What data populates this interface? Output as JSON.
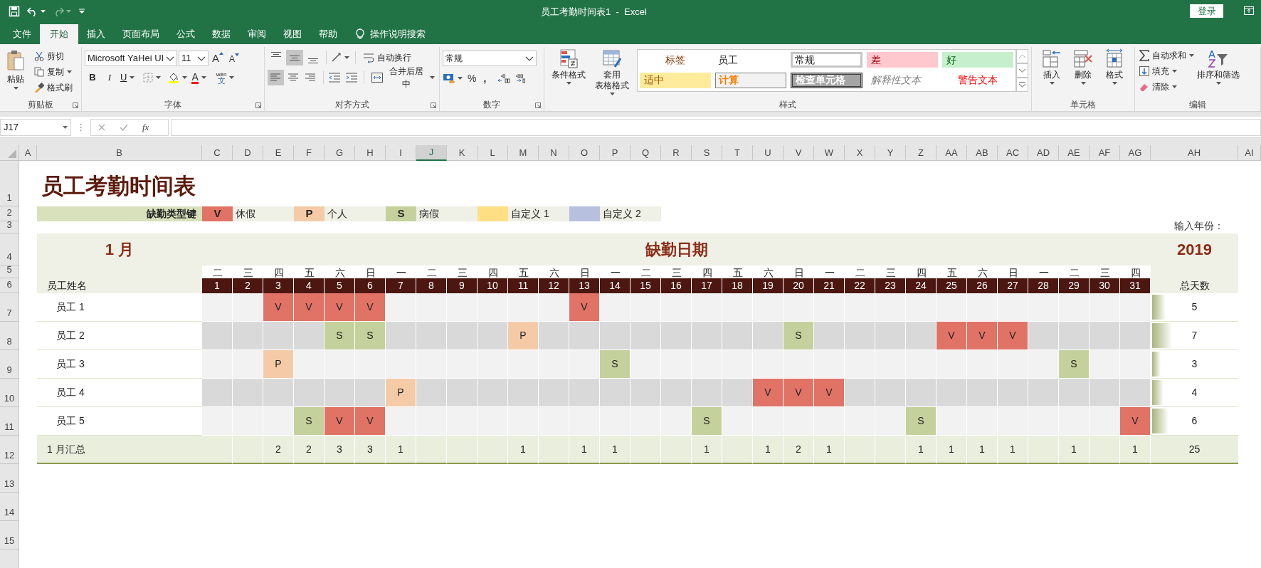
{
  "window": {
    "title": "员工考勤时间表1  -  Excel",
    "sign_in": "登录"
  },
  "ribbon_tabs": [
    {
      "label": "文件",
      "selected": false
    },
    {
      "label": "开始",
      "selected": true
    },
    {
      "label": "插入",
      "selected": false
    },
    {
      "label": "页面布局",
      "selected": false
    },
    {
      "label": "公式",
      "selected": false
    },
    {
      "label": "数据",
      "selected": false
    },
    {
      "label": "审阅",
      "selected": false
    },
    {
      "label": "视图",
      "selected": false
    },
    {
      "label": "帮助",
      "selected": false
    }
  ],
  "tell_me": "操作说明搜索",
  "clipboard": {
    "label": "剪贴板",
    "paste": "粘贴",
    "cut": "剪切",
    "copy": "复制",
    "format_painter": "格式刷"
  },
  "font": {
    "label": "字体",
    "font_name": "Microsoft YaHei UI",
    "font_size": "11",
    "grow": "A",
    "shrink": "A",
    "bold": "B",
    "italic": "I",
    "underline": "U",
    "font_color": "A",
    "phonetic_top": "wén",
    "phonetic_bottom": "文"
  },
  "alignment": {
    "label": "对齐方式",
    "vertical_align_buttons": [
      {
        "selected": false
      },
      {
        "selected": true
      },
      {
        "selected": false
      }
    ],
    "horizontal_align_buttons": [
      {
        "selected": true
      },
      {
        "selected": false
      },
      {
        "selected": false
      }
    ],
    "wrap_text": "自动换行",
    "merge_center": "合并后居中"
  },
  "number": {
    "label": "数字",
    "format": "常规",
    "percent": "%",
    "comma": ","
  },
  "styles": {
    "label": "样式",
    "conditional_formatting": "条件格式",
    "format_as_table": "套用表格格式",
    "gallery": [
      {
        "label": "标签",
        "kind": "heading",
        "selected": false
      },
      {
        "label": "员工",
        "kind": "plain",
        "selected": false
      },
      {
        "label": "常规",
        "kind": "normal",
        "selected": true
      },
      {
        "label": "差",
        "kind": "bad",
        "selected": false
      },
      {
        "label": "好",
        "kind": "good",
        "selected": false
      },
      {
        "label": "适中",
        "kind": "neutral",
        "selected": false
      },
      {
        "label": "计算",
        "kind": "calculation",
        "selected": false
      },
      {
        "label": "检查单元格",
        "kind": "check",
        "selected": false
      },
      {
        "label": "解释性文本",
        "kind": "explanatory",
        "selected": false
      },
      {
        "label": "警告文本",
        "kind": "warning",
        "selected": false
      }
    ]
  },
  "cells": {
    "label": "单元格",
    "insert": "插入",
    "delete": "删除",
    "format": "格式"
  },
  "editing": {
    "label": "编辑",
    "autosum": "自动求和",
    "fill": "填充",
    "clear": "清除",
    "sort_filter": "排序和筛选"
  },
  "formula_bar": {
    "name_box": "J17",
    "fx": "fx"
  },
  "sheet_columns": [
    {
      "label": "A",
      "selected": false
    },
    {
      "label": "B",
      "selected": false
    },
    {
      "label": "C",
      "selected": false
    },
    {
      "label": "D",
      "selected": false
    },
    {
      "label": "E",
      "selected": false
    },
    {
      "label": "F",
      "selected": false
    },
    {
      "label": "G",
      "selected": false
    },
    {
      "label": "H",
      "selected": false
    },
    {
      "label": "I",
      "selected": false
    },
    {
      "label": "J",
      "selected": true
    },
    {
      "label": "K",
      "selected": false
    },
    {
      "label": "L",
      "selected": false
    },
    {
      "label": "M",
      "selected": false
    },
    {
      "label": "N",
      "selected": false
    },
    {
      "label": "O",
      "selected": false
    },
    {
      "label": "P",
      "selected": false
    },
    {
      "label": "Q",
      "selected": false
    },
    {
      "label": "R",
      "selected": false
    },
    {
      "label": "S",
      "selected": false
    },
    {
      "label": "T",
      "selected": false
    },
    {
      "label": "U",
      "selected": false
    },
    {
      "label": "V",
      "selected": false
    },
    {
      "label": "W",
      "selected": false
    },
    {
      "label": "X",
      "selected": false
    },
    {
      "label": "Y",
      "selected": false
    },
    {
      "label": "Z",
      "selected": false
    },
    {
      "label": "AA",
      "selected": false
    },
    {
      "label": "AB",
      "selected": false
    },
    {
      "label": "AC",
      "selected": false
    },
    {
      "label": "AD",
      "selected": false
    },
    {
      "label": "AE",
      "selected": false
    },
    {
      "label": "AF",
      "selected": false
    },
    {
      "label": "AG",
      "selected": false
    },
    {
      "label": "AH",
      "selected": false
    },
    {
      "label": "AI",
      "selected": false
    }
  ],
  "row_numbers": [
    "1",
    "2",
    "3",
    "4",
    "5",
    "6",
    "7",
    "8",
    "9",
    "10",
    "11",
    "12",
    "13",
    "14",
    "15"
  ],
  "sheet": {
    "title": "员工考勤时间表",
    "legend": {
      "label": "缺勤类型键",
      "items": [
        {
          "code": "V",
          "label": "休假",
          "color": "#e07366"
        },
        {
          "code": "P",
          "label": "个人",
          "color": "#f5cba7"
        },
        {
          "code": "S",
          "label": "病假",
          "color": "#c4d19c"
        },
        {
          "label": "自定义 1",
          "color": "#fedf84"
        },
        {
          "label": "自定义 2",
          "color": "#b7c0de"
        }
      ]
    },
    "year_label": "输入年份：",
    "month": "1 月",
    "period_label": "缺勤日期",
    "year": "2019",
    "weekdays": [
      "二",
      "三",
      "四",
      "五",
      "六",
      "日",
      "一",
      "二",
      "三",
      "四",
      "五",
      "六",
      "日",
      "一",
      "二",
      "三",
      "四",
      "五",
      "六",
      "日",
      "一",
      "二",
      "三",
      "四",
      "五",
      "六",
      "日",
      "一",
      "二",
      "三",
      "四"
    ],
    "days": [
      "1",
      "2",
      "3",
      "4",
      "5",
      "6",
      "7",
      "8",
      "9",
      "10",
      "11",
      "12",
      "13",
      "14",
      "15",
      "16",
      "17",
      "18",
      "19",
      "20",
      "21",
      "22",
      "23",
      "24",
      "25",
      "26",
      "27",
      "28",
      "29",
      "30",
      "31"
    ],
    "name_header": "员工姓名",
    "total_header": "总天数",
    "employees": [
      {
        "name": "员工 1",
        "total": "5",
        "level": 0.16,
        "days": [
          {
            "kind": "present"
          },
          {
            "kind": "present"
          },
          {
            "kind": "absent",
            "code": "V",
            "color": "#e07366"
          },
          {
            "kind": "absent",
            "code": "V",
            "color": "#e07366"
          },
          {
            "kind": "absent",
            "code": "V",
            "color": "#e07366"
          },
          {
            "kind": "absent",
            "code": "V",
            "color": "#e07366"
          },
          {
            "kind": "present"
          },
          {
            "kind": "present"
          },
          {
            "kind": "present"
          },
          {
            "kind": "present"
          },
          {
            "kind": "present"
          },
          {
            "kind": "present"
          },
          {
            "kind": "absent",
            "code": "V",
            "color": "#e07366"
          },
          {
            "kind": "present"
          },
          {
            "kind": "present"
          },
          {
            "kind": "present"
          },
          {
            "kind": "present"
          },
          {
            "kind": "present"
          },
          {
            "kind": "present"
          },
          {
            "kind": "present"
          },
          {
            "kind": "present"
          },
          {
            "kind": "present"
          },
          {
            "kind": "present"
          },
          {
            "kind": "present"
          },
          {
            "kind": "present"
          },
          {
            "kind": "present"
          },
          {
            "kind": "present"
          },
          {
            "kind": "present"
          },
          {
            "kind": "present"
          },
          {
            "kind": "present"
          },
          {
            "kind": "present"
          }
        ]
      },
      {
        "name": "员工 2",
        "total": "7",
        "level": 0.23,
        "days": [
          {
            "kind": "present"
          },
          {
            "kind": "present"
          },
          {
            "kind": "present"
          },
          {
            "kind": "present"
          },
          {
            "kind": "absent",
            "code": "S",
            "color": "#c4d19c"
          },
          {
            "kind": "absent",
            "code": "S",
            "color": "#c4d19c"
          },
          {
            "kind": "present"
          },
          {
            "kind": "present"
          },
          {
            "kind": "present"
          },
          {
            "kind": "present"
          },
          {
            "kind": "absent",
            "code": "P",
            "color": "#f5cba7"
          },
          {
            "kind": "present"
          },
          {
            "kind": "present"
          },
          {
            "kind": "present"
          },
          {
            "kind": "present"
          },
          {
            "kind": "present"
          },
          {
            "kind": "present"
          },
          {
            "kind": "present"
          },
          {
            "kind": "present"
          },
          {
            "kind": "absent",
            "code": "S",
            "color": "#c4d19c"
          },
          {
            "kind": "present"
          },
          {
            "kind": "present"
          },
          {
            "kind": "present"
          },
          {
            "kind": "present"
          },
          {
            "kind": "absent",
            "code": "V",
            "color": "#e07366"
          },
          {
            "kind": "absent",
            "code": "V",
            "color": "#e07366"
          },
          {
            "kind": "absent",
            "code": "V",
            "color": "#e07366"
          },
          {
            "kind": "present"
          },
          {
            "kind": "present"
          },
          {
            "kind": "present"
          },
          {
            "kind": "present"
          }
        ]
      },
      {
        "name": "员工 3",
        "total": "3",
        "level": 0.1,
        "days": [
          {
            "kind": "present"
          },
          {
            "kind": "present"
          },
          {
            "kind": "absent",
            "code": "P",
            "color": "#f5cba7"
          },
          {
            "kind": "present"
          },
          {
            "kind": "present"
          },
          {
            "kind": "present"
          },
          {
            "kind": "present"
          },
          {
            "kind": "present"
          },
          {
            "kind": "present"
          },
          {
            "kind": "present"
          },
          {
            "kind": "present"
          },
          {
            "kind": "present"
          },
          {
            "kind": "present"
          },
          {
            "kind": "absent",
            "code": "S",
            "color": "#c4d19c"
          },
          {
            "kind": "present"
          },
          {
            "kind": "present"
          },
          {
            "kind": "present"
          },
          {
            "kind": "present"
          },
          {
            "kind": "present"
          },
          {
            "kind": "present"
          },
          {
            "kind": "present"
          },
          {
            "kind": "present"
          },
          {
            "kind": "present"
          },
          {
            "kind": "present"
          },
          {
            "kind": "present"
          },
          {
            "kind": "present"
          },
          {
            "kind": "present"
          },
          {
            "kind": "present"
          },
          {
            "kind": "absent",
            "code": "S",
            "color": "#c4d19c"
          },
          {
            "kind": "present"
          },
          {
            "kind": "present"
          }
        ]
      },
      {
        "name": "员工 4",
        "total": "4",
        "level": 0.13,
        "days": [
          {
            "kind": "present"
          },
          {
            "kind": "present"
          },
          {
            "kind": "present"
          },
          {
            "kind": "present"
          },
          {
            "kind": "present"
          },
          {
            "kind": "present"
          },
          {
            "kind": "absent",
            "code": "P",
            "color": "#f5cba7"
          },
          {
            "kind": "present"
          },
          {
            "kind": "present"
          },
          {
            "kind": "present"
          },
          {
            "kind": "present"
          },
          {
            "kind": "present"
          },
          {
            "kind": "present"
          },
          {
            "kind": "present"
          },
          {
            "kind": "present"
          },
          {
            "kind": "present"
          },
          {
            "kind": "present"
          },
          {
            "kind": "present"
          },
          {
            "kind": "absent",
            "code": "V",
            "color": "#e07366"
          },
          {
            "kind": "absent",
            "code": "V",
            "color": "#e07366"
          },
          {
            "kind": "absent",
            "code": "V",
            "color": "#e07366"
          },
          {
            "kind": "present"
          },
          {
            "kind": "present"
          },
          {
            "kind": "present"
          },
          {
            "kind": "present"
          },
          {
            "kind": "present"
          },
          {
            "kind": "present"
          },
          {
            "kind": "present"
          },
          {
            "kind": "present"
          },
          {
            "kind": "present"
          },
          {
            "kind": "present"
          }
        ]
      },
      {
        "name": "员工 5",
        "total": "6",
        "level": 0.19,
        "days": [
          {
            "kind": "present"
          },
          {
            "kind": "present"
          },
          {
            "kind": "present"
          },
          {
            "kind": "absent",
            "code": "S",
            "color": "#c4d19c"
          },
          {
            "kind": "absent",
            "code": "V",
            "color": "#e07366"
          },
          {
            "kind": "absent",
            "code": "V",
            "color": "#e07366"
          },
          {
            "kind": "present"
          },
          {
            "kind": "present"
          },
          {
            "kind": "present"
          },
          {
            "kind": "present"
          },
          {
            "kind": "present"
          },
          {
            "kind": "present"
          },
          {
            "kind": "present"
          },
          {
            "kind": "present"
          },
          {
            "kind": "present"
          },
          {
            "kind": "present"
          },
          {
            "kind": "absent",
            "code": "S",
            "color": "#c4d19c"
          },
          {
            "kind": "present"
          },
          {
            "kind": "present"
          },
          {
            "kind": "present"
          },
          {
            "kind": "present"
          },
          {
            "kind": "present"
          },
          {
            "kind": "present"
          },
          {
            "kind": "absent",
            "code": "S",
            "color": "#c4d19c"
          },
          {
            "kind": "present"
          },
          {
            "kind": "present"
          },
          {
            "kind": "present"
          },
          {
            "kind": "present"
          },
          {
            "kind": "present"
          },
          {
            "kind": "present"
          },
          {
            "kind": "absent",
            "code": "V",
            "color": "#e07366"
          }
        ]
      }
    ],
    "summary": {
      "label": "1 月汇总",
      "total": "25",
      "counts": [
        {
          "kind": "blank"
        },
        {
          "kind": "blank"
        },
        {
          "kind": "count",
          "count": "2"
        },
        {
          "kind": "count",
          "count": "2"
        },
        {
          "kind": "count",
          "count": "3"
        },
        {
          "kind": "count",
          "count": "3"
        },
        {
          "kind": "count",
          "count": "1"
        },
        {
          "kind": "blank"
        },
        {
          "kind": "blank"
        },
        {
          "kind": "blank"
        },
        {
          "kind": "count",
          "count": "1"
        },
        {
          "kind": "blank"
        },
        {
          "kind": "count",
          "count": "1"
        },
        {
          "kind": "count",
          "count": "1"
        },
        {
          "kind": "blank"
        },
        {
          "kind": "blank"
        },
        {
          "kind": "count",
          "count": "1"
        },
        {
          "kind": "blank"
        },
        {
          "kind": "count",
          "count": "1"
        },
        {
          "kind": "count",
          "count": "2"
        },
        {
          "kind": "count",
          "count": "1"
        },
        {
          "kind": "blank"
        },
        {
          "kind": "blank"
        },
        {
          "kind": "count",
          "count": "1"
        },
        {
          "kind": "count",
          "count": "1"
        },
        {
          "kind": "count",
          "count": "1"
        },
        {
          "kind": "count",
          "count": "1"
        },
        {
          "kind": "blank"
        },
        {
          "kind": "count",
          "count": "1"
        },
        {
          "kind": "blank"
        },
        {
          "kind": "count",
          "count": "1"
        }
      ]
    }
  }
}
